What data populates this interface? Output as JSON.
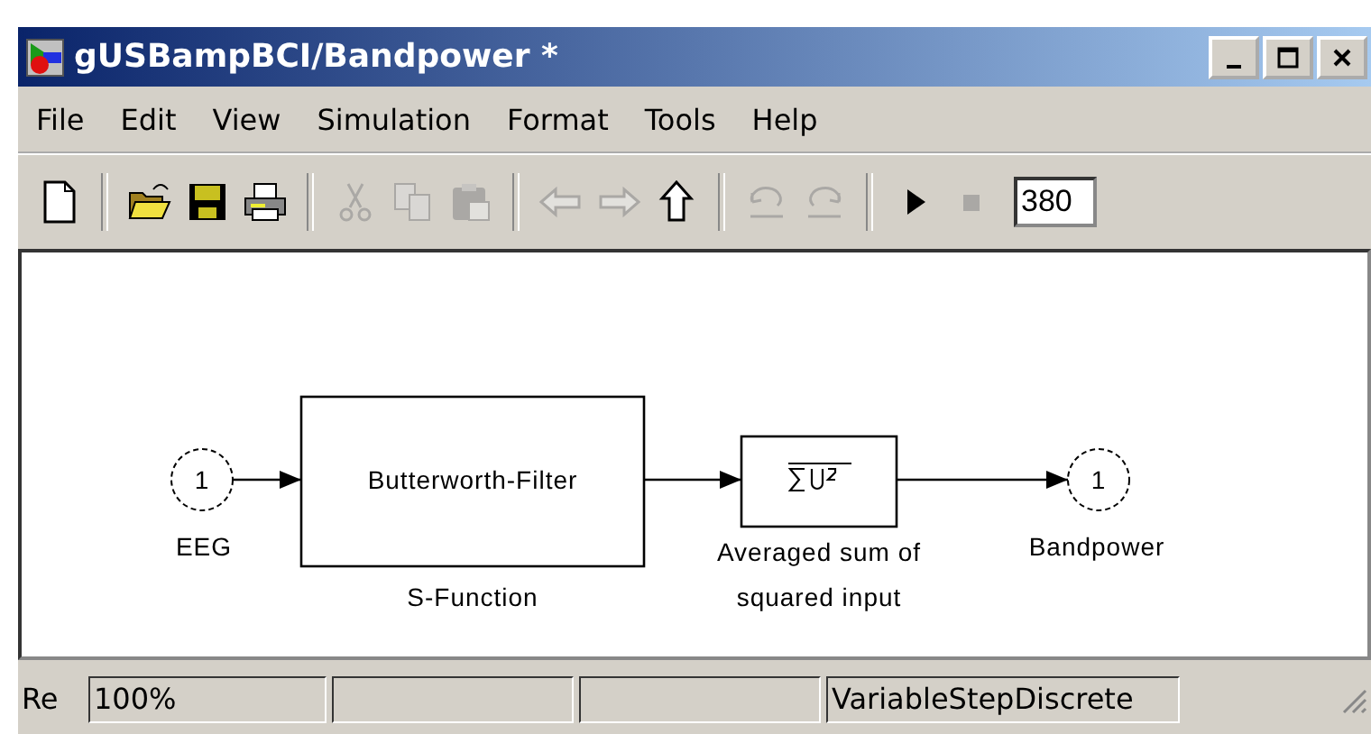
{
  "window": {
    "title": "gUSBampBCI/Bandpower *"
  },
  "menu": [
    "File",
    "Edit",
    "View",
    "Simulation",
    "Format",
    "Tools",
    "Help"
  ],
  "toolbar": [
    {
      "kind": "new",
      "disabled": false
    },
    {
      "kind": "sep"
    },
    {
      "kind": "open",
      "disabled": false
    },
    {
      "kind": "save",
      "disabled": false
    },
    {
      "kind": "print",
      "disabled": false
    },
    {
      "kind": "sep"
    },
    {
      "kind": "cut",
      "disabled": true
    },
    {
      "kind": "copy",
      "disabled": true
    },
    {
      "kind": "paste",
      "disabled": true
    },
    {
      "kind": "sep"
    },
    {
      "kind": "back",
      "disabled": true
    },
    {
      "kind": "forward",
      "disabled": true
    },
    {
      "kind": "up",
      "disabled": false
    },
    {
      "kind": "sep"
    },
    {
      "kind": "undo",
      "disabled": true
    },
    {
      "kind": "redo",
      "disabled": true
    },
    {
      "kind": "sep"
    },
    {
      "kind": "play",
      "disabled": false
    },
    {
      "kind": "stop",
      "disabled": true
    }
  ],
  "stop_time": {
    "value": "380"
  },
  "diagram": {
    "inport": {
      "number": "1",
      "label": "EEG"
    },
    "filter": {
      "text": "Butterworth-Filter",
      "label": "S-Function"
    },
    "sum": {
      "label": "Averaged sum of squared input"
    },
    "outport": {
      "number": "1",
      "label": "Bandpower"
    }
  },
  "status_bar": {
    "label": "Re",
    "zoom": "100%",
    "solver": "VariableStepDiscrete"
  }
}
